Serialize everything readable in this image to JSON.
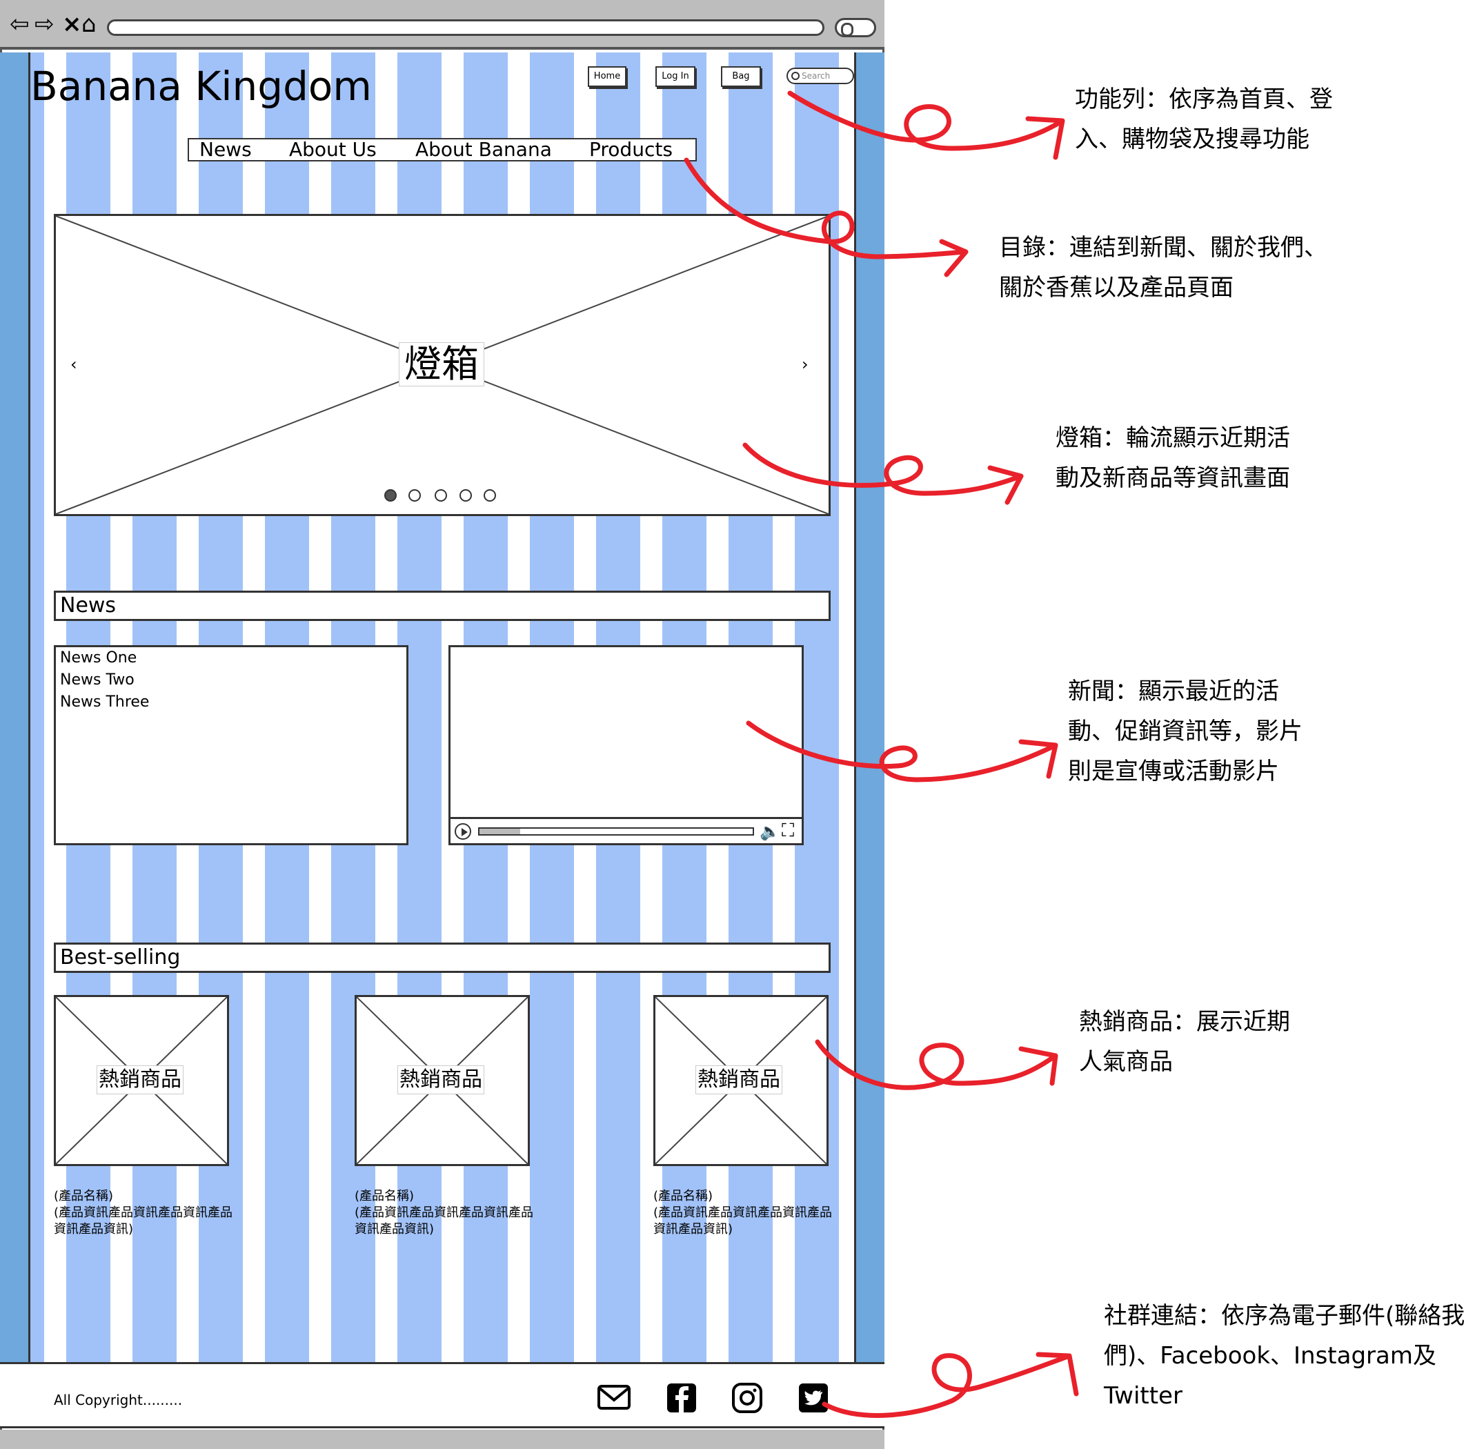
{
  "browser": {
    "nav_icons": [
      "back-icon",
      "forward-icon",
      "close-icon",
      "home-icon"
    ]
  },
  "site": {
    "logo": "Banana Kingdom",
    "toolbar": {
      "home": "Home",
      "login": "Log In",
      "bag": "Bag",
      "search_placeholder": "Search"
    },
    "menu": {
      "news": "News",
      "about_us": "About Us",
      "about_banana": "About Banana",
      "products": "Products"
    },
    "lightbox": {
      "label": "燈箱",
      "prev": "‹",
      "next": "›",
      "dots": 5,
      "active_dot": 0
    },
    "news": {
      "title": "News",
      "items": [
        "News One",
        "News Two",
        "News Three"
      ],
      "video_progress": 0.15
    },
    "best_selling": {
      "title": "Best-selling",
      "products": [
        {
          "label": "熱銷商品",
          "name": "(產品名稱)",
          "info": "(產品資訊產品資訊產品資訊產品資訊產品資訊)"
        },
        {
          "label": "熱銷商品",
          "name": "(產品名稱)",
          "info": "(產品資訊產品資訊產品資訊產品資訊產品資訊)"
        },
        {
          "label": "熱銷商品",
          "name": "(產品名稱)",
          "info": "(產品資訊產品資訊產品資訊產品資訊產品資訊)"
        }
      ]
    },
    "footer": {
      "copyright": "All Copyright.........",
      "social_icons": [
        "email-icon",
        "facebook-icon",
        "instagram-icon",
        "twitter-icon"
      ]
    }
  },
  "colors": {
    "stripe": "#a1c2f8",
    "sidebar": "#6fa8dc",
    "annotation_arrow": "#e8212b"
  },
  "annotations": [
    {
      "line1": "功能列：依序為首頁、登",
      "line2": "入、購物袋及搜尋功能"
    },
    {
      "line1": "目錄：連結到新聞、關於我們、",
      "line2": "關於香蕉以及產品頁面"
    },
    {
      "line1": "燈箱：輪流顯示近期活",
      "line2": "動及新商品等資訊畫面"
    },
    {
      "line1": "新聞：顯示最近的活",
      "line2": "動、促銷資訊等，影片",
      "line3": "則是宣傳或活動影片"
    },
    {
      "line1": "熱銷商品：展示近期",
      "line2": "人氣商品"
    },
    {
      "line1": "社群連結：依序為電子郵件(聯絡我",
      "line2": "們)、Facebook、Instagram及",
      "line3": "Twitter"
    }
  ]
}
